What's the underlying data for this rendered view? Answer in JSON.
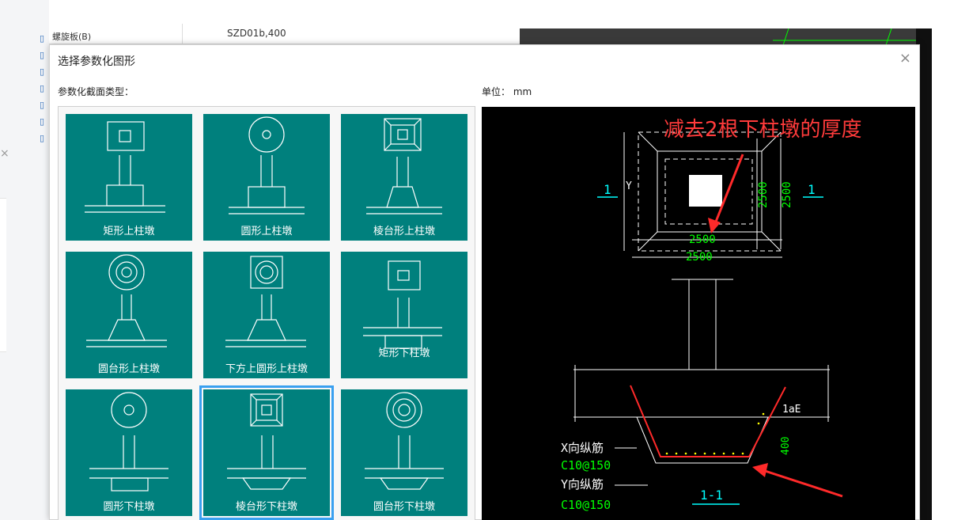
{
  "background": {
    "row_col1": "螺旋板(B)",
    "row_col2": "SZD01b,400",
    "close_x": "×"
  },
  "dialog": {
    "title": "选择参数化图形",
    "close": "×",
    "section_label": "参数化截面类型：",
    "unit_label": "单位：  mm"
  },
  "tiles": [
    "矩形上柱墩",
    "圆形上柱墩",
    "棱台形上柱墩",
    "圆台形上柱墩",
    "下方上圆形上柱墩",
    "矩形下柱墩",
    "圆形下柱墩",
    "棱台形下柱墩",
    "圆台形下柱墩"
  ],
  "selected_tile": "棱台形下柱墩",
  "preview": {
    "annotation": "减去2根下柱墩的厚度",
    "dim_inner": "2500",
    "dim_outer": "2500",
    "dim_v1": "2500",
    "dim_v2": "2500",
    "axis_y": "Y",
    "section_mark": "1",
    "section_label": "1-1",
    "lae": "1aE",
    "dim_400": "400",
    "x_rebar": "X向纵筋",
    "x_rebar_spec": "C10@150",
    "y_rebar": "Y向纵筋",
    "y_rebar_spec": "C10@150"
  },
  "colors": {
    "tile_bg": "#00807d",
    "selection": "#3aa0f0",
    "annotation": "#ff3b3b",
    "dim_green": "#00ff00",
    "cyan": "#00ffff"
  }
}
